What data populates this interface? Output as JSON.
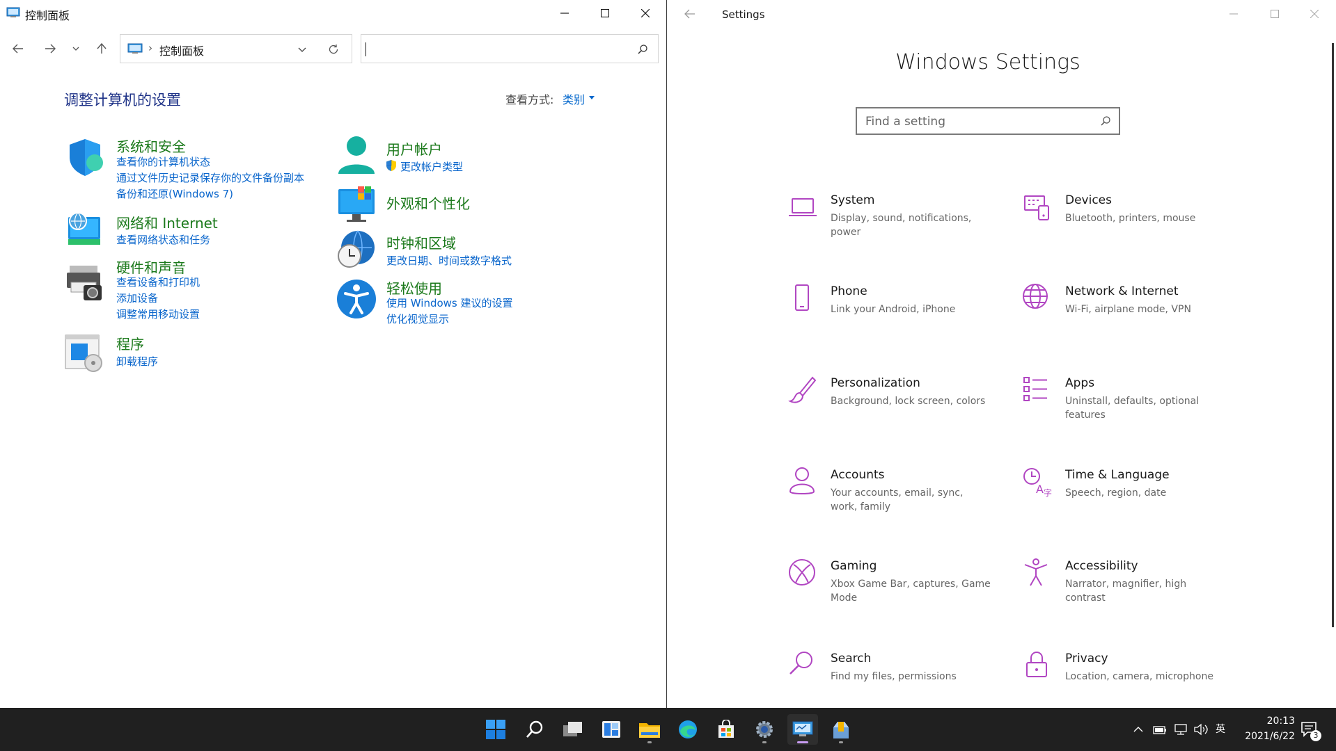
{
  "control_panel": {
    "window_title": "控制面板",
    "address_crumb": "控制面板",
    "search_value": "",
    "heading": "调整计算机的设置",
    "view_by_label": "查看方式:",
    "view_by_value": "类别",
    "categories": [
      {
        "title": "系统和安全",
        "icon": "shield-icon",
        "links": [
          "查看你的计算机状态",
          "通过文件历史记录保存你的文件备份副本",
          "备份和还原(Windows 7)"
        ]
      },
      {
        "title": "网络和 Internet",
        "icon": "network-globe-icon",
        "links": [
          "查看网络状态和任务"
        ]
      },
      {
        "title": "硬件和声音",
        "icon": "printer-icon",
        "links": [
          "查看设备和打印机",
          "添加设备",
          "调整常用移动设置"
        ]
      },
      {
        "title": "程序",
        "icon": "programs-icon",
        "links": [
          "卸载程序"
        ]
      },
      {
        "title": "用户帐户",
        "icon": "user-icon",
        "links": [
          "更改帐户类型"
        ]
      },
      {
        "title": "外观和个性化",
        "icon": "monitor-icon",
        "links": []
      },
      {
        "title": "时钟和区域",
        "icon": "clock-globe-icon",
        "links": [
          "更改日期、时间或数字格式"
        ]
      },
      {
        "title": "轻松使用",
        "icon": "accessibility-icon",
        "links": [
          "使用 Windows 建议的设置",
          "优化视觉显示"
        ]
      }
    ]
  },
  "settings": {
    "window_title": "Settings",
    "heading": "Windows Settings",
    "search_placeholder": "Find a setting",
    "accent_color": "#b146c2",
    "tiles": [
      {
        "name": "System",
        "desc": "Display, sound, notifications, power",
        "icon": "laptop-icon"
      },
      {
        "name": "Devices",
        "desc": "Bluetooth, printers, mouse",
        "icon": "keyboard-icon"
      },
      {
        "name": "Phone",
        "desc": "Link your Android, iPhone",
        "icon": "phone-icon"
      },
      {
        "name": "Network & Internet",
        "desc": "Wi-Fi, airplane mode, VPN",
        "icon": "globe-icon"
      },
      {
        "name": "Personalization",
        "desc": "Background, lock screen, colors",
        "icon": "brush-icon"
      },
      {
        "name": "Apps",
        "desc": "Uninstall, defaults, optional features",
        "icon": "apps-list-icon"
      },
      {
        "name": "Accounts",
        "desc": "Your accounts, email, sync, work, family",
        "icon": "person-icon"
      },
      {
        "name": "Time & Language",
        "desc": "Speech, region, date",
        "icon": "time-language-icon"
      },
      {
        "name": "Gaming",
        "desc": "Xbox Game Bar, captures, Game Mode",
        "icon": "xbox-icon"
      },
      {
        "name": "Accessibility",
        "desc": "Narrator, magnifier, high contrast",
        "icon": "accessibility-person-icon"
      },
      {
        "name": "Search",
        "desc": "Find my files, permissions",
        "icon": "search-icon"
      },
      {
        "name": "Privacy",
        "desc": "Location, camera, microphone",
        "icon": "lock-icon"
      }
    ]
  },
  "taskbar": {
    "apps": [
      "start-icon",
      "search-icon",
      "task-view-icon",
      "widgets-icon",
      "file-explorer-icon",
      "edge-icon",
      "store-icon",
      "settings-gear-icon",
      "control-panel-icon",
      "installer-icon"
    ],
    "ime": "英",
    "time": "20:13",
    "date": "2021/6/22",
    "notification_count": "3"
  }
}
